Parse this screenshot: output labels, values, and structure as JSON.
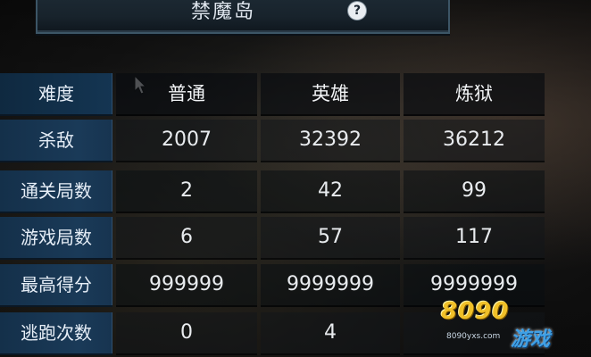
{
  "header": {
    "title": "禁魔岛",
    "help_glyph": "?"
  },
  "table": {
    "head_label": "难度",
    "columns": [
      "普通",
      "英雄",
      "炼狱"
    ],
    "rows": [
      {
        "label": "杀敌",
        "values": [
          "2007",
          "32392",
          "36212"
        ]
      },
      {
        "label": "通关局数",
        "values": [
          "2",
          "42",
          "99"
        ]
      },
      {
        "label": "游戏局数",
        "values": [
          "6",
          "57",
          "117"
        ]
      },
      {
        "label": "最高得分",
        "values": [
          "999999",
          "9999999",
          "9999999"
        ]
      },
      {
        "label": "逃跑次数",
        "values": [
          "0",
          "4",
          ""
        ]
      }
    ]
  },
  "watermark": {
    "top": "8090",
    "bottom": "游戏",
    "url": "8090yxs.com"
  },
  "colors": {
    "label_bg": "#1a3a58",
    "accent": "#3c5566"
  }
}
